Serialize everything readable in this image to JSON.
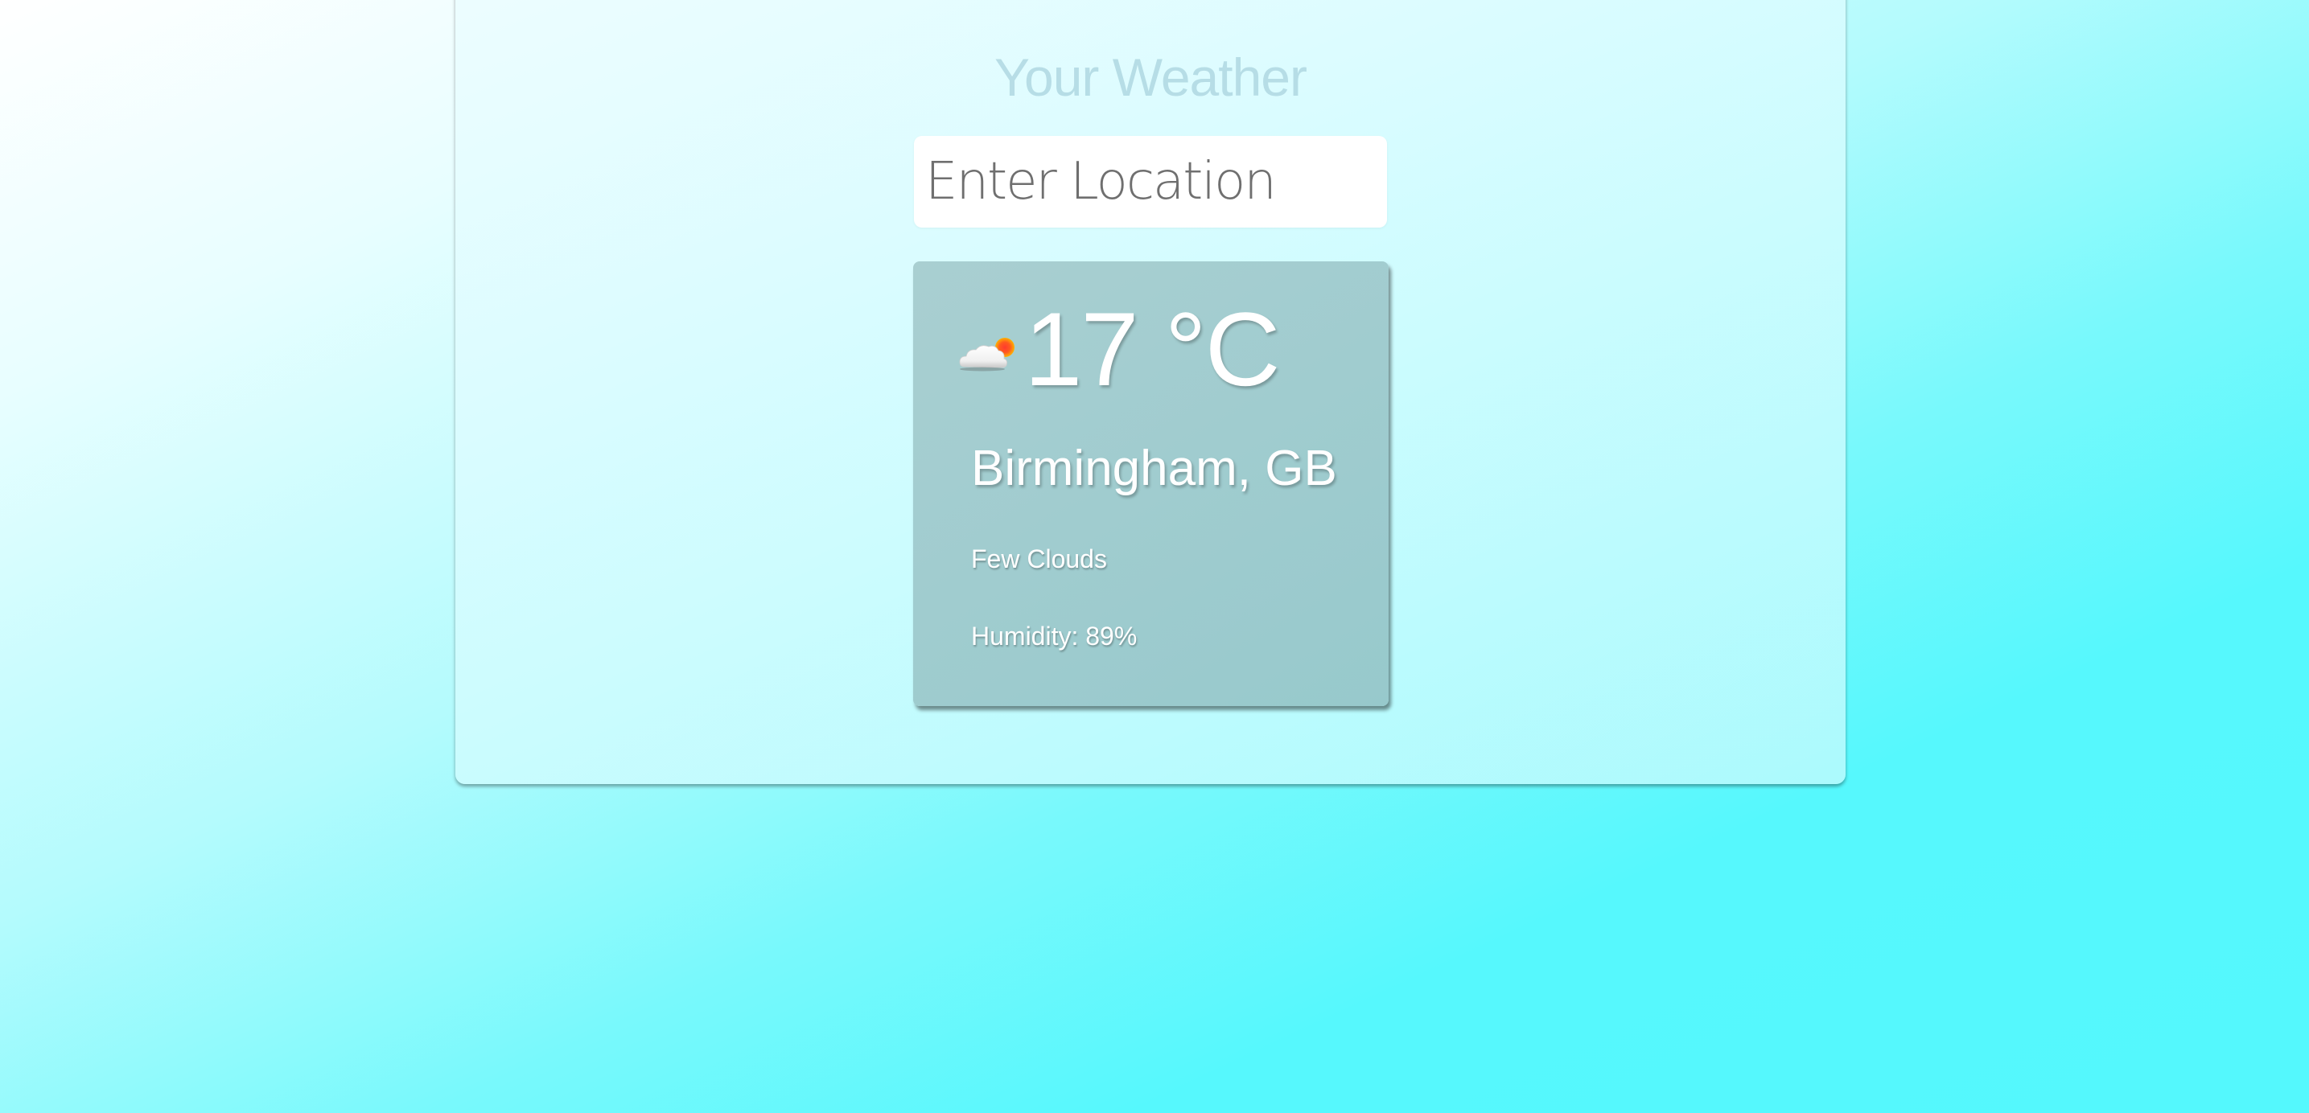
{
  "app": {
    "title": "Your Weather"
  },
  "search": {
    "placeholder": "Enter Location",
    "value": ""
  },
  "weather": {
    "icon": "few-clouds-day-icon",
    "temperature": "17 °C",
    "location": "Birmingham, GB",
    "description": "Few Clouds",
    "humidity_label": "Humidity:",
    "humidity_value": "89%"
  },
  "colors": {
    "background_accent": "#54f8fd",
    "card": "#a0cccf",
    "card_text": "#ffffff",
    "title_text": "#afd7e2"
  }
}
